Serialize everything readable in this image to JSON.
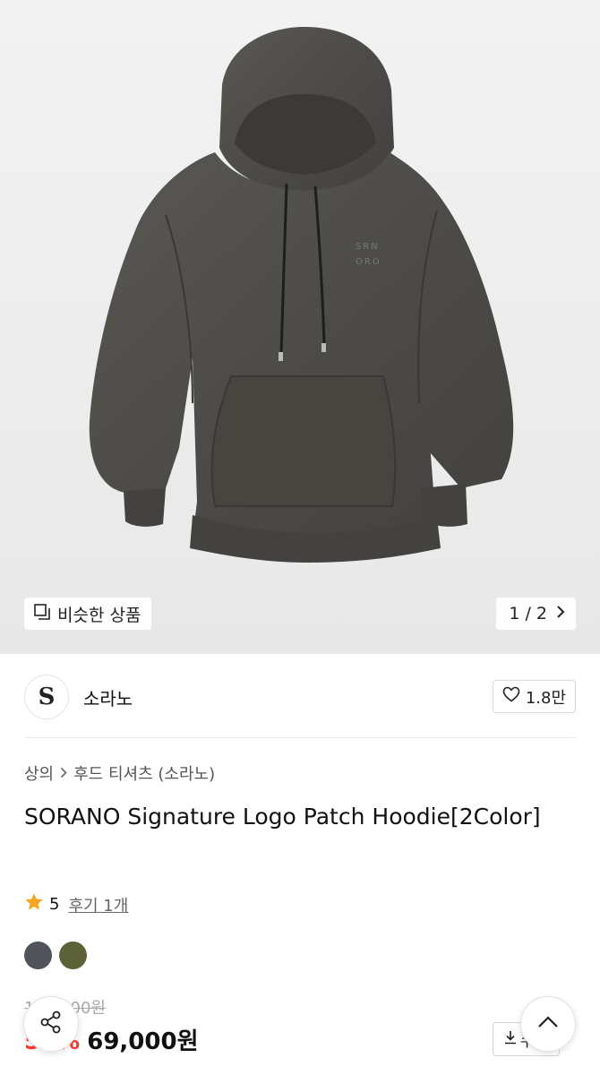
{
  "gallery": {
    "similar_label": "비슷한 상품",
    "pagination": "1 / 2",
    "logo_line1": "SRN",
    "logo_line2": "ORO"
  },
  "brand": {
    "logo_letter": "S",
    "name": "소라노",
    "likes": "1.8만"
  },
  "breadcrumb": {
    "category": "상의",
    "subcategory": "후드 티셔츠 (소라노)"
  },
  "product": {
    "title": "SORANO Signature Logo Patch Hoodie[2Color]",
    "rating": "5",
    "review_label": "후기 1개",
    "colors": [
      "#50535a",
      "#5d6137"
    ],
    "original_price": "138,000원",
    "discount": "50%",
    "sale_price": "69,000원",
    "coupon_label": "쿠폰"
  },
  "icons": {
    "share": "share-icon",
    "scroll_top": "chevron-up-icon",
    "similar": "copy-icon",
    "next": "chevron-right-icon",
    "heart": "heart-icon",
    "download": "download-icon",
    "star": "star-icon"
  },
  "colors": {
    "discount": "#ff3b30",
    "star": "#f5a623",
    "hoodie": "#4d4b47"
  }
}
